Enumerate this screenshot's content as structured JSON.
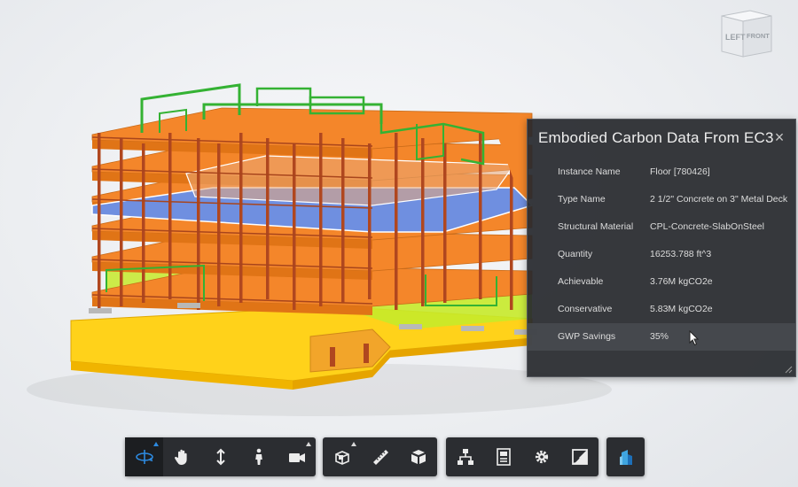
{
  "viewcube": {
    "left_label": "LEFT",
    "front_label": "FRONT"
  },
  "panel": {
    "title": "Embodied Carbon Data From EC3",
    "close_glyph": "×",
    "rows": [
      {
        "name": "Instance Name",
        "value": "Floor [780426]"
      },
      {
        "name": "Type Name",
        "value": "2 1/2\" Concrete on 3\" Metal Deck"
      },
      {
        "name": "Structural Material",
        "value": "CPL-Concrete-SlabOnSteel"
      },
      {
        "name": "Quantity",
        "value": "16253.788 ft^3"
      },
      {
        "name": "Achievable",
        "value": "3.76M kgCO2e"
      },
      {
        "name": "Conservative",
        "value": "5.83M kgCO2e"
      },
      {
        "name": "GWP Savings",
        "value": "35%"
      }
    ]
  },
  "toolbar": {
    "groups": [
      {
        "tools": [
          {
            "name": "orbit-tool",
            "icon": "orbit-icon",
            "active": true,
            "flyout": true
          },
          {
            "name": "pan-tool",
            "icon": "hand-icon"
          },
          {
            "name": "zoom-tool",
            "icon": "zoom-arrows-icon"
          },
          {
            "name": "first-person-tool",
            "icon": "person-icon"
          },
          {
            "name": "camera-tool",
            "icon": "camera-icon",
            "flyout": true
          }
        ]
      },
      {
        "tools": [
          {
            "name": "section-tool",
            "icon": "section-box-icon",
            "flyout": true
          },
          {
            "name": "measure-tool",
            "icon": "ruler-icon"
          },
          {
            "name": "explode-tool",
            "icon": "explode-cube-icon"
          }
        ]
      },
      {
        "tools": [
          {
            "name": "model-browser-tool",
            "icon": "hierarchy-icon"
          },
          {
            "name": "properties-tool",
            "icon": "properties-icon"
          },
          {
            "name": "settings-tool",
            "icon": "gear-icon"
          },
          {
            "name": "fullscreen-tool",
            "icon": "fullscreen-icon"
          }
        ]
      },
      {
        "tools": [
          {
            "name": "building-extension-tool",
            "icon": "building-icon"
          }
        ]
      }
    ]
  },
  "colors": {
    "slab_orange": "#f4862a",
    "column": "#b0471f",
    "green_wire": "#34b233",
    "selected_slab": "#6f8fe0",
    "yellow": "#ffd21a",
    "lime": "#c6ea2a"
  }
}
